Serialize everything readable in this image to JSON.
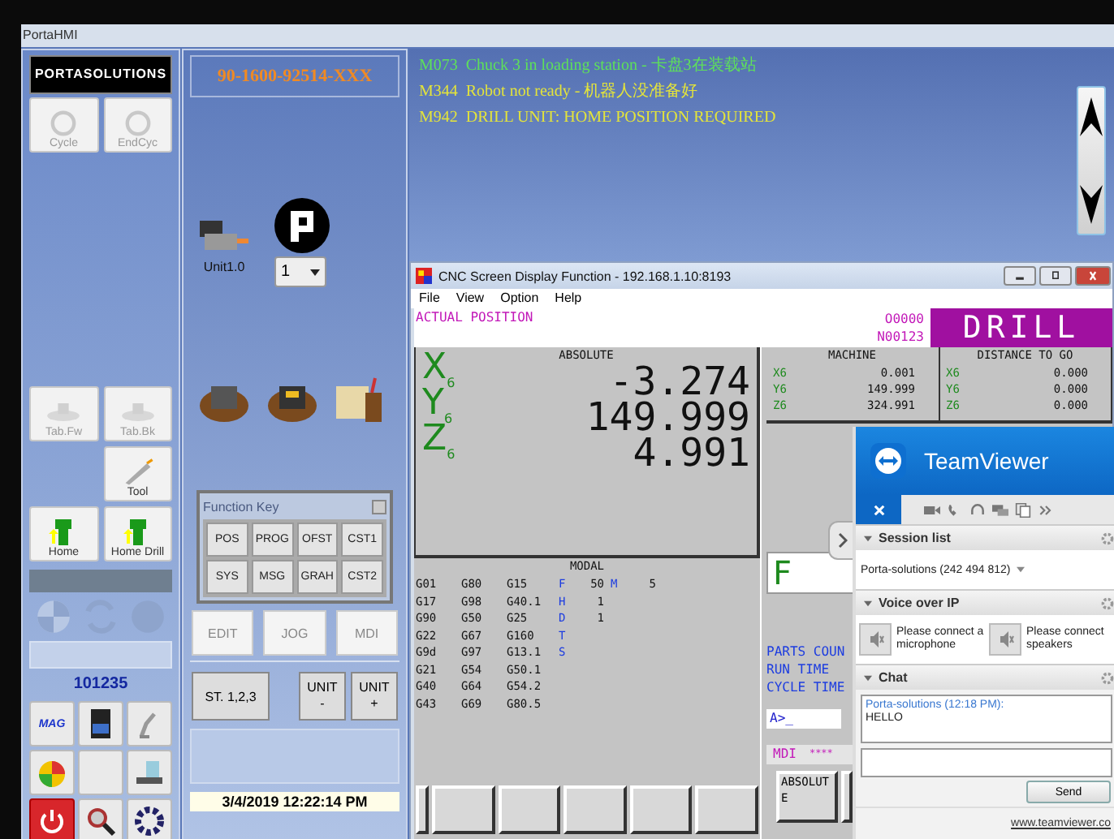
{
  "window": {
    "title": "PortaHMI"
  },
  "left_panel": {
    "logo": "PORTASOLUTIONS",
    "top_buttons": [
      {
        "label": "Cycle",
        "disabled": true
      },
      {
        "label": "EndCyc",
        "disabled": true
      }
    ],
    "table_buttons": [
      {
        "label": "Tab.Fw",
        "disabled": true
      },
      {
        "label": "Tab.Bk",
        "disabled": true
      }
    ],
    "tool_button": {
      "label": "Tool",
      "disabled": false
    },
    "home_buttons": [
      {
        "label": "Home",
        "disabled": false
      },
      {
        "label": "Home Drill",
        "disabled": false
      }
    ],
    "counter": "101235",
    "mag_label": "MAG"
  },
  "middle_panel": {
    "part_number": "90-1600-92514-XXX",
    "unit_label": "Unit1.0",
    "unit_select": "1",
    "function_key": {
      "title": "Function Key",
      "keys": [
        "POS",
        "PROG",
        "OFST",
        "CST1",
        "SYS",
        "MSG",
        "GRAH",
        "CST2"
      ]
    },
    "modes": [
      "EDIT",
      "JOG",
      "MDI"
    ],
    "station_button": "ST. 1,2,3",
    "unit_buttons": [
      {
        "label": "UNIT",
        "sign": "-"
      },
      {
        "label": "UNIT",
        "sign": "+"
      }
    ],
    "datetime": "3/4/2019 12:22:14 PM"
  },
  "messages": [
    {
      "code": "M073",
      "text": "Chuck 3 in loading station - 卡盘3在装载站",
      "color": "#5ee05a"
    },
    {
      "code": "M344",
      "text": "Robot not ready - 机器人没准备好",
      "color": "#e4e43a"
    },
    {
      "code": "M942",
      "text": "DRILL UNIT: HOME POSITION REQUIRED",
      "color": "#e4e43a"
    }
  ],
  "cnc_window": {
    "title": "CNC Screen Display Function - 192.168.1.10:8193",
    "menu": [
      "File",
      "View",
      "Option",
      "Help"
    ],
    "header": "ACTUAL POSITION",
    "program": "O0000",
    "sequence": "N00123",
    "mode": "DRILL",
    "absolute": {
      "title": "ABSOLUTE",
      "axes": [
        {
          "axis": "X",
          "sub": "6",
          "value": "-3.274"
        },
        {
          "axis": "Y",
          "sub": "6",
          "value": "149.999"
        },
        {
          "axis": "Z",
          "sub": "6",
          "value": "4.991"
        }
      ]
    },
    "machine": {
      "title": "MACHINE",
      "axes": [
        {
          "axis": "X6",
          "value": "0.001"
        },
        {
          "axis": "Y6",
          "value": "149.999"
        },
        {
          "axis": "Z6",
          "value": "324.991"
        }
      ]
    },
    "distance": {
      "title": "DISTANCE TO GO",
      "axes": [
        {
          "axis": "X6",
          "value": "0.000"
        },
        {
          "axis": "Y6",
          "value": "0.000"
        },
        {
          "axis": "Z6",
          "value": "0.000"
        }
      ]
    },
    "modal": {
      "title": "MODAL",
      "rows": [
        {
          "codes": [
            "G01",
            "G80",
            "G15"
          ],
          "address": "F",
          "value": "50",
          "address2": "M",
          "value2": "5"
        },
        {
          "codes": [
            "G17",
            "G98",
            "G40.1"
          ],
          "address": "H",
          "value": "1"
        },
        {
          "codes": [
            "G90",
            "G50",
            "G25"
          ],
          "address": "D",
          "value": "1"
        },
        {
          "codes": [
            "G22",
            "G67",
            "G160"
          ],
          "address": "T"
        },
        {
          "codes": [
            "G9d",
            "G97",
            "G13.1"
          ],
          "address": "S"
        },
        {
          "codes": [
            "G21",
            "G54",
            "G50.1"
          ]
        },
        {
          "codes": [
            "G40",
            "G64",
            "G54.2"
          ]
        },
        {
          "codes": [
            "G43",
            "G69",
            "G80.5"
          ]
        }
      ]
    },
    "feed_label": "F",
    "counters": [
      "PARTS COUN",
      "RUN TIME",
      "CYCLE TIME"
    ],
    "prompt": "A>_",
    "status": "MDI",
    "status_stars": "****",
    "softkey": "ABSOLUTE"
  },
  "teamviewer": {
    "title": "TeamViewer",
    "session": {
      "title": "Session list",
      "entry": "Porta-solutions (242 494 812)"
    },
    "voip": {
      "title": "Voice over IP",
      "items": [
        "Please connect a microphone",
        "Please connect speakers"
      ]
    },
    "chat": {
      "title": "Chat",
      "sender": "Porta-solutions (12:18 PM):",
      "message": "HELLO",
      "send": "Send"
    },
    "footer": "www.teamviewer.co"
  }
}
